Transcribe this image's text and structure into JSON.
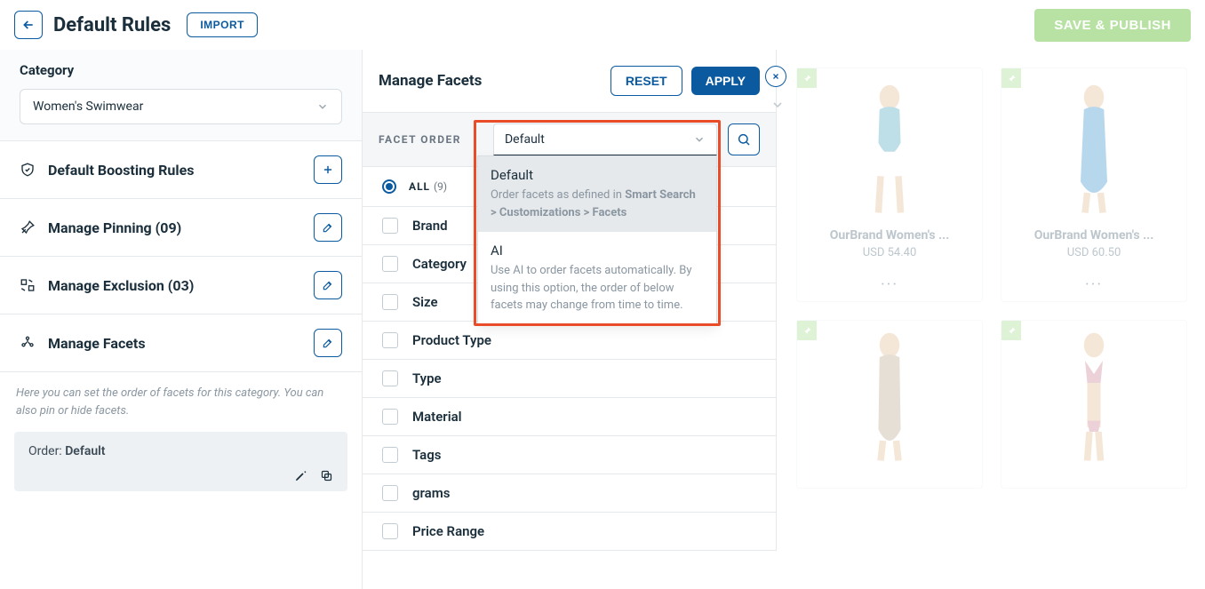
{
  "header": {
    "title": "Default Rules",
    "import_label": "IMPORT",
    "save_label": "SAVE & PUBLISH"
  },
  "sidebar": {
    "category_label": "Category",
    "category_value": "Women's Swimwear",
    "items": [
      {
        "label": "Default Boosting Rules",
        "action": "plus"
      },
      {
        "label": "Manage Pinning (09)",
        "action": "edit"
      },
      {
        "label": "Manage Exclusion (03)",
        "action": "edit"
      },
      {
        "label": "Manage Facets",
        "action": "edit"
      }
    ],
    "facet_note": "Here you can set the order of facets for this category. You can also pin or hide facets.",
    "order_prefix": "Order:",
    "order_value": "Default"
  },
  "facets": {
    "panel_title": "Manage Facets",
    "reset_label": "RESET",
    "apply_label": "APPLY",
    "order_label": "FACET ORDER",
    "order_selected": "Default",
    "order_options": [
      {
        "title": "Default",
        "desc_before": "Order facets as defined in ",
        "desc_strong": "Smart Search > Customizations > Facets",
        "desc_after": ""
      },
      {
        "title": "AI",
        "desc_before": "Use AI to order facets automatically. By using this option, the order of below facets may change from time to time.",
        "desc_strong": "",
        "desc_after": ""
      }
    ],
    "all_label": "ALL",
    "all_count": "(9)",
    "list": [
      "Brand",
      "Category",
      "Size",
      "Product Type",
      "Type",
      "Material",
      "Tags",
      "grams",
      "Price Range"
    ]
  },
  "products": [
    {
      "title": "OurBrand Women's ...",
      "price": "USD 54.40"
    },
    {
      "title": "OurBrand Women's ...",
      "price": "USD 60.50"
    },
    {
      "title": "",
      "price": ""
    },
    {
      "title": "",
      "price": ""
    }
  ]
}
